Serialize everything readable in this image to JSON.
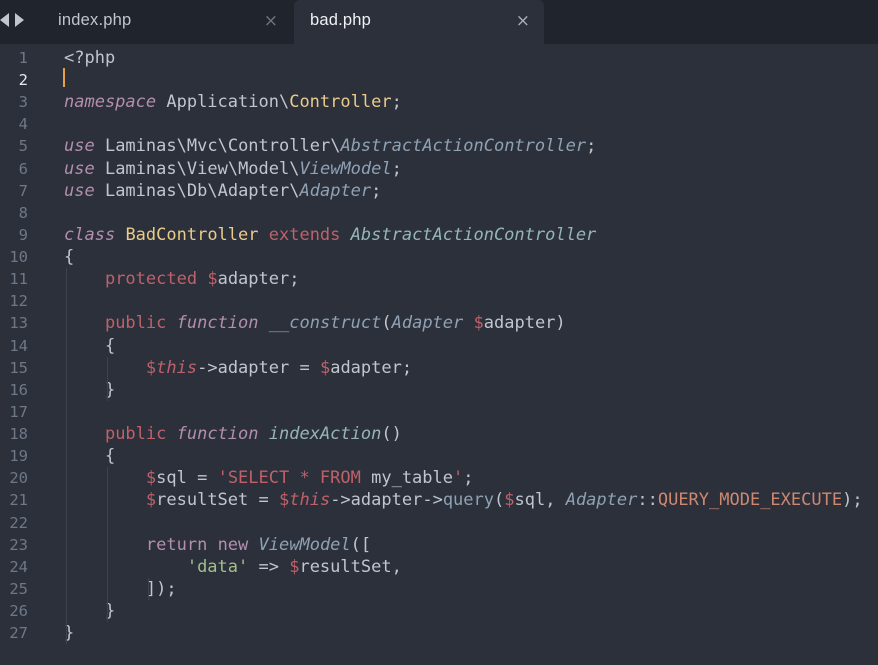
{
  "tabs": [
    {
      "label": "index.php",
      "close": "×",
      "active": false
    },
    {
      "label": "bad.php",
      "close": "×",
      "active": true
    }
  ],
  "editor": {
    "current_line": 2,
    "line_numbers": [
      "1",
      "2",
      "3",
      "4",
      "5",
      "6",
      "7",
      "8",
      "9",
      "10",
      "11",
      "12",
      "13",
      "14",
      "15",
      "16",
      "17",
      "18",
      "19",
      "20",
      "21",
      "22",
      "23",
      "24",
      "25",
      "26",
      "27"
    ],
    "lines": [
      [
        {
          "t": "<?php",
          "c": "t-tag"
        }
      ],
      [],
      [
        {
          "t": "namespace",
          "c": "t-kw"
        },
        {
          "t": " Application",
          "c": "t-plain"
        },
        {
          "t": "\\",
          "c": "t-punc"
        },
        {
          "t": "Controller",
          "c": "t-cls"
        },
        {
          "t": ";",
          "c": "t-punc"
        }
      ],
      [],
      [
        {
          "t": "use",
          "c": "t-kw"
        },
        {
          "t": " Laminas",
          "c": "t-plain"
        },
        {
          "t": "\\",
          "c": "t-punc"
        },
        {
          "t": "Mvc",
          "c": "t-plain"
        },
        {
          "t": "\\",
          "c": "t-punc"
        },
        {
          "t": "Controller",
          "c": "t-plain"
        },
        {
          "t": "\\",
          "c": "t-punc"
        },
        {
          "t": "AbstractActionController",
          "c": "t-iface"
        },
        {
          "t": ";",
          "c": "t-punc"
        }
      ],
      [
        {
          "t": "use",
          "c": "t-kw"
        },
        {
          "t": " Laminas",
          "c": "t-plain"
        },
        {
          "t": "\\",
          "c": "t-punc"
        },
        {
          "t": "View",
          "c": "t-plain"
        },
        {
          "t": "\\",
          "c": "t-punc"
        },
        {
          "t": "Model",
          "c": "t-plain"
        },
        {
          "t": "\\",
          "c": "t-punc"
        },
        {
          "t": "ViewModel",
          "c": "t-iface"
        },
        {
          "t": ";",
          "c": "t-punc"
        }
      ],
      [
        {
          "t": "use",
          "c": "t-kw"
        },
        {
          "t": " Laminas",
          "c": "t-plain"
        },
        {
          "t": "\\",
          "c": "t-punc"
        },
        {
          "t": "Db",
          "c": "t-plain"
        },
        {
          "t": "\\",
          "c": "t-punc"
        },
        {
          "t": "Adapter",
          "c": "t-plain"
        },
        {
          "t": "\\",
          "c": "t-punc"
        },
        {
          "t": "Adapter",
          "c": "t-iface"
        },
        {
          "t": ";",
          "c": "t-punc"
        }
      ],
      [],
      [
        {
          "t": "class",
          "c": "t-kw"
        },
        {
          "t": " ",
          "c": "t-plain"
        },
        {
          "t": "BadController",
          "c": "t-type"
        },
        {
          "t": " ",
          "c": "t-plain"
        },
        {
          "t": "extends",
          "c": "t-mod"
        },
        {
          "t": " ",
          "c": "t-plain"
        },
        {
          "t": "AbstractActionController",
          "c": "t-entity"
        }
      ],
      [
        {
          "t": "{",
          "c": "t-punc"
        }
      ],
      [
        {
          "t": "    ",
          "c": "t-plain"
        },
        {
          "t": "protected",
          "c": "t-mod"
        },
        {
          "t": " ",
          "c": "t-plain"
        },
        {
          "t": "$",
          "c": "t-dollar"
        },
        {
          "t": "adapter",
          "c": "t-var"
        },
        {
          "t": ";",
          "c": "t-punc"
        }
      ],
      [],
      [
        {
          "t": "    ",
          "c": "t-plain"
        },
        {
          "t": "public",
          "c": "t-mod"
        },
        {
          "t": " ",
          "c": "t-plain"
        },
        {
          "t": "function",
          "c": "t-fn"
        },
        {
          "t": " ",
          "c": "t-plain"
        },
        {
          "t": "__construct",
          "c": "t-param-t"
        },
        {
          "t": "(",
          "c": "t-punc"
        },
        {
          "t": "Adapter",
          "c": "t-param-t"
        },
        {
          "t": " ",
          "c": "t-plain"
        },
        {
          "t": "$",
          "c": "t-dollar"
        },
        {
          "t": "adapter",
          "c": "t-var"
        },
        {
          "t": ")",
          "c": "t-punc"
        }
      ],
      [
        {
          "t": "    {",
          "c": "t-punc"
        }
      ],
      [
        {
          "t": "        ",
          "c": "t-plain"
        },
        {
          "t": "$",
          "c": "t-dollar"
        },
        {
          "t": "this",
          "c": "t-this"
        },
        {
          "t": "->",
          "c": "t-arrow"
        },
        {
          "t": "adapter",
          "c": "t-var"
        },
        {
          "t": " = ",
          "c": "t-op"
        },
        {
          "t": "$",
          "c": "t-dollar"
        },
        {
          "t": "adapter",
          "c": "t-var"
        },
        {
          "t": ";",
          "c": "t-punc"
        }
      ],
      [
        {
          "t": "    }",
          "c": "t-punc"
        }
      ],
      [],
      [
        {
          "t": "    ",
          "c": "t-plain"
        },
        {
          "t": "public",
          "c": "t-mod"
        },
        {
          "t": " ",
          "c": "t-plain"
        },
        {
          "t": "function",
          "c": "t-fn"
        },
        {
          "t": " ",
          "c": "t-plain"
        },
        {
          "t": "indexAction",
          "c": "t-entity"
        },
        {
          "t": "()",
          "c": "t-punc"
        }
      ],
      [
        {
          "t": "    {",
          "c": "t-punc"
        }
      ],
      [
        {
          "t": "        ",
          "c": "t-plain"
        },
        {
          "t": "$",
          "c": "t-dollar"
        },
        {
          "t": "sql",
          "c": "t-var"
        },
        {
          "t": " = ",
          "c": "t-op"
        },
        {
          "t": "'SELECT * FROM ",
          "c": "t-mod"
        },
        {
          "t": "my_table",
          "c": "t-plain"
        },
        {
          "t": "'",
          "c": "t-mod"
        },
        {
          "t": ";",
          "c": "t-punc"
        }
      ],
      [
        {
          "t": "        ",
          "c": "t-plain"
        },
        {
          "t": "$",
          "c": "t-dollar"
        },
        {
          "t": "resultSet",
          "c": "t-var"
        },
        {
          "t": " = ",
          "c": "t-op"
        },
        {
          "t": "$",
          "c": "t-dollar"
        },
        {
          "t": "this",
          "c": "t-this"
        },
        {
          "t": "->",
          "c": "t-arrow"
        },
        {
          "t": "adapter",
          "c": "t-var"
        },
        {
          "t": "->",
          "c": "t-arrow"
        },
        {
          "t": "query",
          "c": "t-call"
        },
        {
          "t": "(",
          "c": "t-punc"
        },
        {
          "t": "$",
          "c": "t-dollar"
        },
        {
          "t": "sql",
          "c": "t-var"
        },
        {
          "t": ", ",
          "c": "t-punc"
        },
        {
          "t": "Adapter",
          "c": "t-param-t"
        },
        {
          "t": "::",
          "c": "t-punc"
        },
        {
          "t": "QUERY_MODE_EXECUTE",
          "c": "t-orange"
        },
        {
          "t": ");",
          "c": "t-punc"
        }
      ],
      [],
      [
        {
          "t": "        ",
          "c": "t-plain"
        },
        {
          "t": "return",
          "c": "t-ret"
        },
        {
          "t": " ",
          "c": "t-plain"
        },
        {
          "t": "new",
          "c": "t-new"
        },
        {
          "t": " ",
          "c": "t-plain"
        },
        {
          "t": "ViewModel",
          "c": "t-param-t"
        },
        {
          "t": "([",
          "c": "t-punc"
        }
      ],
      [
        {
          "t": "            ",
          "c": "t-plain"
        },
        {
          "t": "'data'",
          "c": "t-str"
        },
        {
          "t": " => ",
          "c": "t-op"
        },
        {
          "t": "$",
          "c": "t-dollar"
        },
        {
          "t": "resultSet",
          "c": "t-var"
        },
        {
          "t": ",",
          "c": "t-punc"
        }
      ],
      [
        {
          "t": "        ]);",
          "c": "t-punc"
        }
      ],
      [
        {
          "t": "    }",
          "c": "t-punc"
        }
      ],
      [
        {
          "t": "}",
          "c": "t-punc"
        }
      ]
    ]
  }
}
